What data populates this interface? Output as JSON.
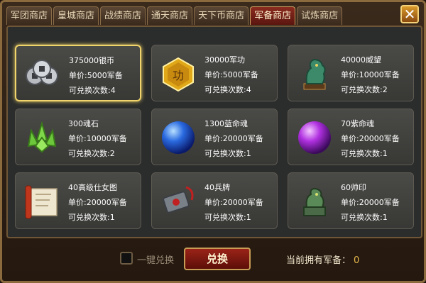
{
  "tabs": [
    {
      "label": "军团商店",
      "active": false
    },
    {
      "label": "皇城商店",
      "active": false
    },
    {
      "label": "战绩商店",
      "active": false
    },
    {
      "label": "通天商店",
      "active": false
    },
    {
      "label": "天下币商店",
      "active": false
    },
    {
      "label": "军备商店",
      "active": true
    },
    {
      "label": "试炼商店",
      "active": false
    }
  ],
  "close_label": "✕",
  "items": [
    {
      "name": "375000银币",
      "price": "单价:5000军备",
      "remaining": "可兑换次数:4",
      "icon": "silver-coins-icon",
      "selected": true
    },
    {
      "name": "30000军功",
      "price": "单价:5000军备",
      "remaining": "可兑换次数:4",
      "icon": "merit-medal-icon",
      "selected": false
    },
    {
      "name": "40000威望",
      "price": "单价:10000军备",
      "remaining": "可兑换次数:2",
      "icon": "dragon-statue-icon",
      "selected": false
    },
    {
      "name": "300魂石",
      "price": "单价:10000军备",
      "remaining": "可兑换次数:2",
      "icon": "soul-stone-icon",
      "selected": false
    },
    {
      "name": "1300蓝命魂",
      "price": "单价:20000军备",
      "remaining": "可兑换次数:1",
      "icon": "blue-orb-icon",
      "selected": false
    },
    {
      "name": "70紫命魂",
      "price": "单价:20000军备",
      "remaining": "可兑换次数:1",
      "icon": "purple-orb-icon",
      "selected": false
    },
    {
      "name": "40高级仕女图",
      "price": "单价:20000军备",
      "remaining": "可兑换次数:1",
      "icon": "scroll-icon",
      "selected": false
    },
    {
      "name": "40兵牌",
      "price": "单价:20000军备",
      "remaining": "可兑换次数:1",
      "icon": "token-icon",
      "selected": false
    },
    {
      "name": "60帅印",
      "price": "单价:20000军备",
      "remaining": "可兑换次数:1",
      "icon": "seal-icon",
      "selected": false
    }
  ],
  "bottom": {
    "one_click_label": "一键兑换",
    "one_click_checked": false,
    "exchange_label": "兑换",
    "owned_label": "当前拥有军备：",
    "owned_value": "0"
  }
}
